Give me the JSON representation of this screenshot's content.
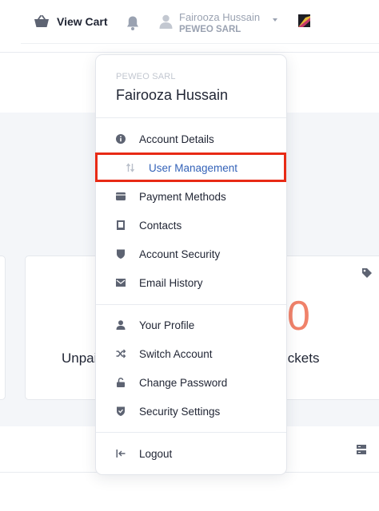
{
  "topbar": {
    "cart_label": "View Cart",
    "user_name": "Fairooza Hussain",
    "user_company": "PEWEO SARL"
  },
  "background": {
    "card_text_left": "Unpai",
    "card_text_right": "ickets",
    "big_number": "0"
  },
  "dropdown": {
    "company": "PEWEO SARL",
    "name": "Fairooza Hussain",
    "group1": [
      {
        "label": "Account Details",
        "icon": "info-icon"
      },
      {
        "label": "User Management",
        "icon": "sort-arrows-icon",
        "active": true
      },
      {
        "label": "Payment Methods",
        "icon": "wallet-icon"
      },
      {
        "label": "Contacts",
        "icon": "contact-card-icon"
      },
      {
        "label": "Account Security",
        "icon": "shield-icon"
      },
      {
        "label": "Email History",
        "icon": "envelope-icon"
      }
    ],
    "group2": [
      {
        "label": "Your Profile",
        "icon": "user-icon"
      },
      {
        "label": "Switch Account",
        "icon": "shuffle-icon"
      },
      {
        "label": "Change Password",
        "icon": "unlock-icon"
      },
      {
        "label": "Security Settings",
        "icon": "shield-check-icon"
      }
    ],
    "logout_label": "Logout"
  },
  "colors": {
    "accent": "#3563b8",
    "highlight": "#e82a15",
    "big_number": "#f0826a"
  }
}
